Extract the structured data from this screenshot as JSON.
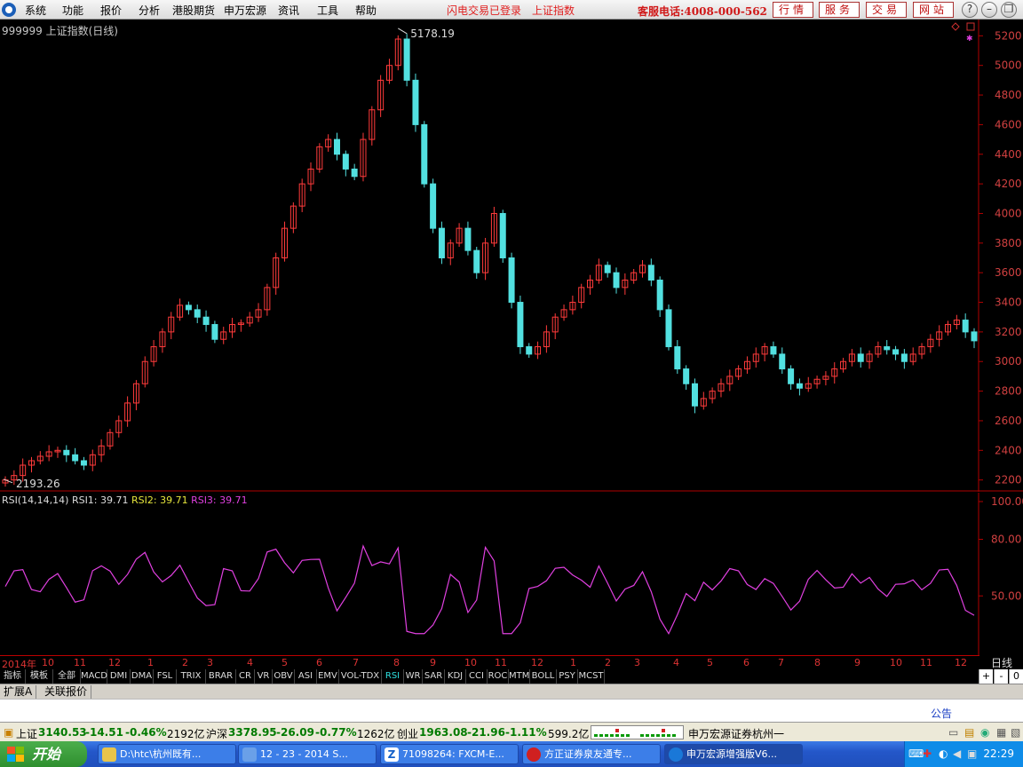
{
  "menu": {
    "items": [
      "系统",
      "功能",
      "报价",
      "分析",
      "港股期货",
      "申万宏源",
      "资讯",
      "工具",
      "帮助"
    ],
    "status_login": "闪电交易已登录",
    "status_index": "上证指数",
    "hotline": "客服电话:4008-000-562",
    "buttons": [
      "行情",
      "服务",
      "交易",
      "网站"
    ],
    "window_controls": [
      "?",
      "–",
      "❐",
      "✕"
    ]
  },
  "chart": {
    "title": "999999 上证指数(日线)",
    "high_label": "5178.19",
    "low_label": "2193.26"
  },
  "rsi_legend": {
    "name": "RSI(14,14,14)",
    "rsi1": "RSI1: 39.71",
    "rsi2": "RSI2: 39.71",
    "rsi3": "RSI3: 39.71"
  },
  "date_axis": {
    "labels": [
      "2014年",
      "10",
      "11",
      "12",
      "1",
      "2",
      "3",
      "4",
      "5",
      "6",
      "7",
      "8",
      "9",
      "10",
      "11",
      "12",
      "1",
      "2",
      "3",
      "4",
      "5",
      "6",
      "7",
      "8",
      "9",
      "10",
      "11",
      "12"
    ],
    "period": "日线"
  },
  "tabs": {
    "items": [
      "指标",
      "模板",
      "全部",
      "MACD",
      "DMI",
      "DMA",
      "FSL",
      "TRIX",
      "BRAR",
      "CR",
      "VR",
      "OBV",
      "ASI",
      "EMV",
      "VOL-TDX",
      "RSI",
      "WR",
      "SAR",
      "KDJ",
      "CCI",
      "ROC",
      "MTM",
      "BOLL",
      "PSY",
      "MCST"
    ],
    "active": "RSI",
    "controls": [
      "+",
      "-",
      "0"
    ]
  },
  "ext_tabs": [
    "扩展A",
    "关联报价"
  ],
  "notice": "公告",
  "quotes": [
    {
      "name": "上证",
      "price": "3140.53",
      "change": "-14.51",
      "pct": "-0.46%",
      "amount": "2192亿"
    },
    {
      "name": "沪深",
      "price": "3378.95",
      "change": "-26.09",
      "pct": "-0.77%",
      "amount": "1262亿"
    },
    {
      "name": "创业",
      "price": "1963.08",
      "change": "-21.96",
      "pct": "-1.11%",
      "amount": "599.2亿"
    }
  ],
  "broker": "申万宏源证券杭州一",
  "taskbar": {
    "start": "开始",
    "tasks": [
      "D:\\htc\\杭州既有...",
      "12 - 23 - 2014 S...",
      "71098264: FXCM-E...",
      "方正证券泉友通专...",
      "申万宏源增强版V6..."
    ],
    "clock": "22:29"
  },
  "chart_data": {
    "type": "candlestick",
    "title": "999999 上证指数(日线)",
    "y_ticks": [
      2200,
      2400,
      2600,
      2800,
      3000,
      3200,
      3400,
      3600,
      3800,
      4000,
      4200,
      4400,
      4600,
      4800,
      5000,
      5200
    ],
    "ylim": [
      2150,
      5250
    ],
    "x_labels": [
      "2014年",
      "10",
      "11",
      "12",
      "1",
      "2",
      "3",
      "4",
      "5",
      "6",
      "7",
      "8",
      "9",
      "10",
      "11",
      "12",
      "1",
      "2",
      "3",
      "4",
      "5",
      "6",
      "7",
      "8",
      "9",
      "10",
      "11",
      "12"
    ],
    "series_close_approx": [
      2200,
      2230,
      2300,
      2330,
      2360,
      2390,
      2400,
      2370,
      2330,
      2300,
      2370,
      2430,
      2520,
      2600,
      2720,
      2850,
      3000,
      3100,
      3200,
      3300,
      3380,
      3350,
      3300,
      3250,
      3150,
      3200,
      3250,
      3260,
      3300,
      3350,
      3500,
      3700,
      3900,
      4050,
      4200,
      4300,
      4450,
      4500,
      4400,
      4300,
      4250,
      4500,
      4700,
      4900,
      5000,
      5178,
      4900,
      4600,
      4200,
      3900,
      3700,
      3800,
      3900,
      3750,
      3600,
      3800,
      4000,
      3700,
      3400,
      3100,
      3050,
      3100,
      3200,
      3300,
      3350,
      3400,
      3500,
      3550,
      3650,
      3600,
      3500,
      3550,
      3600,
      3650,
      3550,
      3350,
      3100,
      2950,
      2850,
      2700,
      2750,
      2800,
      2850,
      2900,
      2950,
      3000,
      3050,
      3100,
      3050,
      2950,
      2850,
      2820,
      2850,
      2880,
      2900,
      2950,
      3000,
      3050,
      3000,
      3050,
      3100,
      3080,
      3050,
      3000,
      3050,
      3100,
      3150,
      3200,
      3250,
      3280,
      3200,
      3140
    ],
    "high": 5178.19,
    "low": 2193.26,
    "rsi": {
      "name": "RSI(14,14,14)",
      "y_ticks": [
        50.0,
        80.0,
        100.0
      ],
      "last": 39.71
    }
  }
}
